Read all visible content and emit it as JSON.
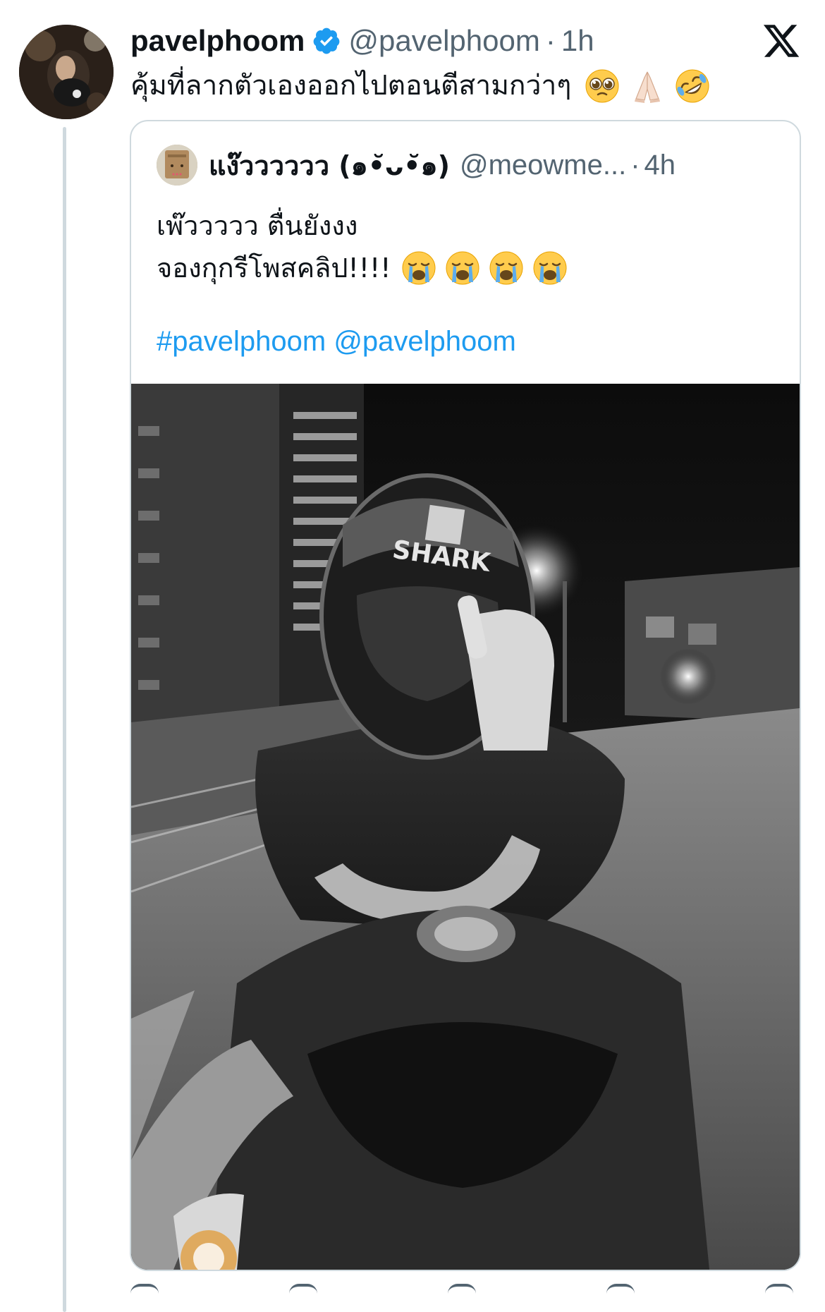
{
  "tweet": {
    "display_name": "pavelphoom",
    "handle": "@pavelphoom",
    "separator": "·",
    "time": "1h",
    "text": "คุ้มที่ลากตัวเองออกไปตอนตีสามกว่าๆ",
    "emojis": [
      "pleading-face",
      "folded-hands",
      "rolling-on-floor-laughing"
    ]
  },
  "quote": {
    "display_name": "แง๊วววววว (๑•̆ᴗ•̆๑)",
    "handle": "@meowme...",
    "separator": "·",
    "time": "4h",
    "line1": "เพ๊ววววว ตื่นยังงง",
    "line2": "จองกุกรีโพสคลิป!!!!",
    "line2_emojis": [
      "loudly-crying-face",
      "loudly-crying-face",
      "loudly-crying-face",
      "loudly-crying-face"
    ],
    "hashtag": "#pavelphoom",
    "mention": "@pavelphoom",
    "media_helmet_text": "SHARK"
  },
  "colors": {
    "text_primary": "#0f1419",
    "text_secondary": "#536471",
    "link": "#1d9bf0",
    "border": "#cfd9de",
    "verified": "#1d9bf0"
  },
  "icons": {
    "verified": "verified-badge-icon",
    "platform": "x-logo-icon"
  }
}
